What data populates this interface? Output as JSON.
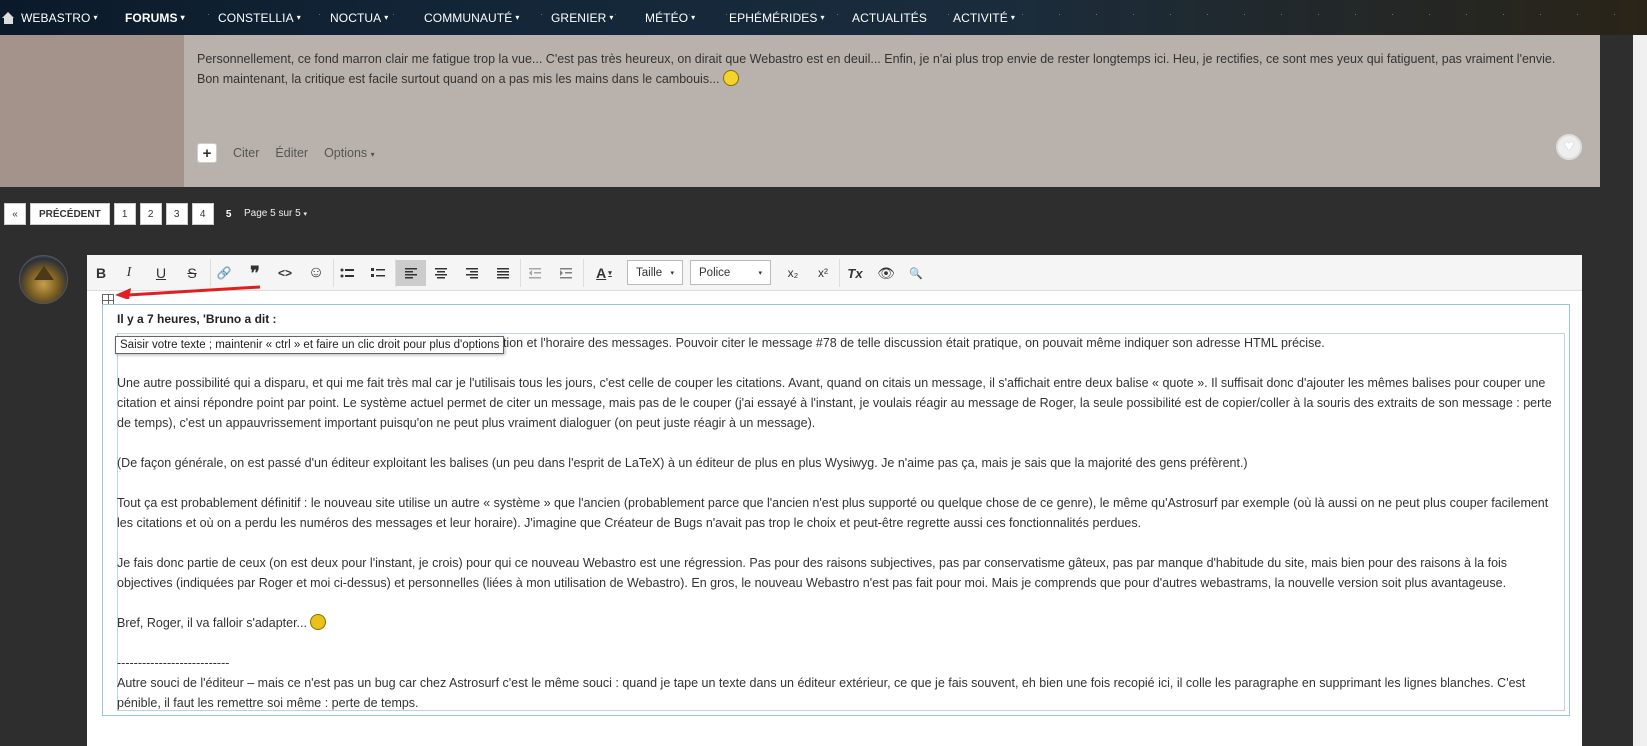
{
  "nav": {
    "items": [
      {
        "label": "WEBASTRO",
        "caret": "▾"
      },
      {
        "label": "FORUMS",
        "caret": "▾"
      },
      {
        "label": "CONSTELLIA",
        "caret": "▾"
      },
      {
        "label": "NOCTUA",
        "caret": "▾"
      },
      {
        "label": "COMMUNAUTÉ",
        "caret": "▾"
      },
      {
        "label": "GRENIER",
        "caret": "▾"
      },
      {
        "label": "MÉTÉO",
        "caret": "▾"
      },
      {
        "label": "EPHÉMÉRIDES",
        "caret": "▾"
      },
      {
        "label": "ACTUALITÉS",
        "caret": ""
      },
      {
        "label": "ACTIVITÉ",
        "caret": "▾"
      }
    ]
  },
  "post": {
    "text": "Personnellement, ce fond marron clair me fatigue trop la vue... C'est pas très heureux, on dirait que Webastro est en deuil... Enfin, je n'ai plus trop envie de rester longtemps ici. Heu, je rectifies, ce sont mes yeux qui fatiguent, pas vraiment l'envie. Bon maintenant, la critique est facile surtout quand on a pas mis les mains dans le cambouis...",
    "actions": {
      "plus": "+",
      "quote": "Citer",
      "edit": "Éditer",
      "options": "Options",
      "options_caret": "▾"
    },
    "heart": "♥"
  },
  "pagination": {
    "first": "«",
    "prev": "PRÉCÉDENT",
    "pages": [
      "1",
      "2",
      "3",
      "4",
      "5"
    ],
    "current": "5",
    "page_of": "Page 5 sur 5",
    "page_of_caret": "▾"
  },
  "editor": {
    "toolbar": {
      "bold": "B",
      "italic": "I",
      "underline": "U",
      "strike": "S",
      "link": "🔗",
      "quote": "❞",
      "code": "<>",
      "emoji": "☺",
      "text_color": "A",
      "size_label": "Taille",
      "font_label": "Police",
      "subscript": "x₂",
      "superscript": "x²",
      "remove_format": "Tx",
      "preview": "👁",
      "preview2": "🔍"
    },
    "quote_header": "Il y a 7 heures, 'Bruno a dit :",
    "tooltip": "Saisir votre texte ; maintenir « ctrl » et faire un clic droit pour plus d'options",
    "paragraphs": [
      "ation et l'horaire des messages. Pouvoir citer le message #78 de telle discussion était pratique, on pouvait même indiquer son adresse HTML précise.",
      "Une autre possibilité qui a disparu, et qui me fait très mal car je l'utilisais tous les jours, c'est celle de couper les citations. Avant, quand on citais un message, il s'affichait entre deux balise « quote ». Il suffisait donc d'ajouter les mêmes balises pour couper une citation et ainsi répondre point par point. Le système actuel permet de citer un message, mais pas de le couper (j'ai essayé à l'instant, je voulais réagir au message de Roger, la seule possibilité est de copier/coller à la souris des extraits de son message : perte de temps), c'est un appauvrissement important puisqu'on ne peut plus vraiment dialoguer (on peut juste réagir à un message).",
      "(De façon générale, on est passé d'un éditeur exploitant les balises (un peu dans l'esprit de LaTeX) à un éditeur de plus en plus Wysiwyg. Je n'aime pas ça, mais je sais que la majorité des gens préfèrent.)",
      "Tout ça est probablement définitif : le nouveau site utilise un autre « système » que l'ancien (probablement parce que l'ancien n'est plus supporté ou quelque chose de ce genre), le même qu'Astrosurf par exemple (où là aussi on ne peut plus couper facilement les citations et où on a perdu les numéros des messages et leur horaire). J'imagine que Créateur de Bugs n'avait pas trop le choix et peut-être regrette aussi ces fonctionnalités perdues.",
      "Je fais donc partie de ceux (on est deux pour l'instant, je crois) pour qui ce nouveau Webastro est une régression. Pas pour des raisons subjectives, pas par conservatisme gâteux, pas par manque d'habitude du site, mais bien pour des raisons à la fois objectives (indiquées par Roger et moi ci-dessus) et personnelles (liées à mon utilisation de Webastro). En gros, le nouveau Webastro n'est pas fait pour moi. Mais je comprends que pour d'autres webastrams, la nouvelle version soit plus avantageuse.",
      "Bref, Roger, il va falloir s'adapter...",
      "---------------------------",
      "Autre souci de l'éditeur – mais ce n'est pas un bug car chez Astrosurf c'est le même souci : quand je tape un texte dans un éditeur extérieur, ce que je fais souvent, eh bien une fois recopié ici, il colle les paragraphe en supprimant les lignes blanches. C'est pénible, il faut les remettre soi même : perte de temps."
    ]
  },
  "colors": {
    "post_bg": "#b9b2ac",
    "page_bg": "#2e2e2e",
    "arrow": "#e02020"
  }
}
